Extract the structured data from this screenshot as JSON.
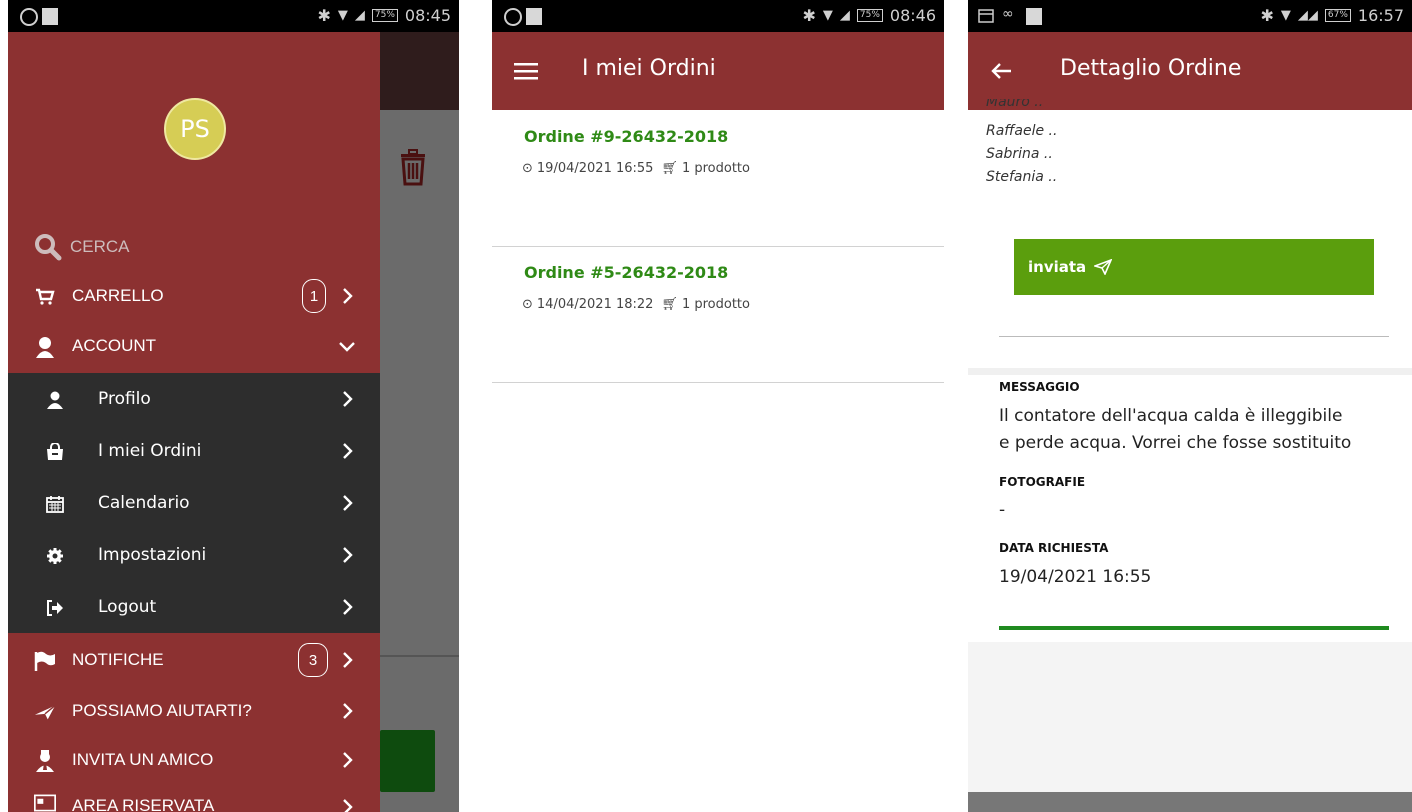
{
  "status_bars": [
    {
      "time": "08:45",
      "battery": "75%"
    },
    {
      "time": "08:46",
      "battery": "75%"
    },
    {
      "time": "16:57",
      "battery": "67%"
    }
  ],
  "drawer": {
    "avatar_initials": "PS",
    "search_label": "CERCA",
    "items": [
      {
        "label": "CARRELLO",
        "icon": "cart-icon",
        "badge": "1"
      },
      {
        "label": "ACCOUNT",
        "icon": "user-icon"
      },
      {
        "label": "NOTIFICHE",
        "icon": "flag-icon",
        "badge": "3"
      },
      {
        "label": "POSSIAMO AIUTARTI?",
        "icon": "paper-plane-icon"
      },
      {
        "label": "INVITA UN AMICO",
        "icon": "user-tie-icon"
      },
      {
        "label": "AREA RISERVATA",
        "icon": "id-card-icon"
      }
    ],
    "account_sub": [
      {
        "label": "Profilo",
        "icon": "user-icon"
      },
      {
        "label": "I miei Ordini",
        "icon": "shopping-bag-icon"
      },
      {
        "label": "Calendario",
        "icon": "calendar-icon"
      },
      {
        "label": "Impostazioni",
        "icon": "gear-icon"
      },
      {
        "label": "Logout",
        "icon": "logout-icon"
      }
    ]
  },
  "orders_screen": {
    "title": "I miei Ordini",
    "orders": [
      {
        "title": "Ordine #9-26432-2018",
        "date": "19/04/2021 16:55",
        "count": "1 prodotto"
      },
      {
        "title": "Ordine #5-26432-2018",
        "date": "14/04/2021 18:22",
        "count": "1 prodotto"
      }
    ]
  },
  "detail_screen": {
    "title": "Dettaglio Ordine",
    "names": [
      "Mauro ..",
      "Raffaele ..",
      "Sabrina ..",
      "Stefania .."
    ],
    "status_button": "inviata",
    "message_label": "MESSAGGIO",
    "message_text_line1": "Il contatore dell'acqua calda è illeggibile",
    "message_text_line2": "e perde acqua. Vorrei che fosse sostituito",
    "photos_label": "FOTOGRAFIE",
    "photos_value": "-",
    "date_label": "DATA RICHIESTA",
    "date_value": "19/04/2021 16:55"
  },
  "colors": {
    "brand": "#8c3131",
    "dark_menu": "#2d2d2d",
    "order_green": "#2f8a16",
    "status_green": "#5b9e0d"
  }
}
